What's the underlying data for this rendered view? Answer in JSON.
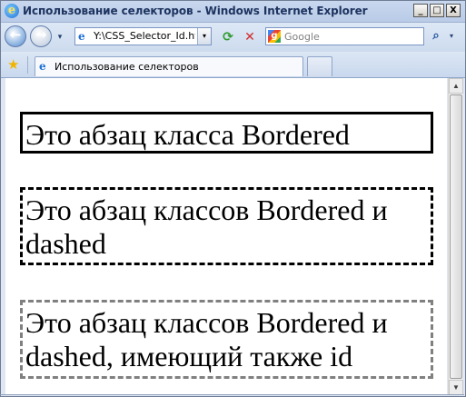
{
  "window": {
    "title": "Использование селекторов - Windows Internet Explorer",
    "app_icon_glyph": "e",
    "controls": {
      "minimize": "_",
      "maximize": "□",
      "close": "X"
    }
  },
  "navigation": {
    "back_glyph": "←",
    "forward_glyph": "→",
    "history_glyph": "▾",
    "address": "Y:\\CSS_Selector_Id.ht",
    "address_dropdown_glyph": "▾",
    "refresh_glyph": "⟳",
    "stop_glyph": "✕",
    "search_provider_icon": "g",
    "search_placeholder": "Google",
    "search_go_glyph": "⌕",
    "search_dropdown_glyph": "▾"
  },
  "tabs": {
    "favorites_glyph": "★",
    "active_tab_icon": "e",
    "active_tab_label": "Использование селекторов"
  },
  "content": {
    "paragraphs": [
      {
        "text": "Это абзац класса Bordered",
        "border_style": "solid",
        "border_color": "#000000"
      },
      {
        "text": "Это абзац классов Bordered и dashed",
        "border_style": "dashed",
        "border_color": "#000000"
      },
      {
        "text": "Это абзац классов Bordered и dashed, имеющий также id",
        "border_style": "dashed",
        "border_color": "#808080"
      }
    ]
  },
  "scrollbar": {
    "up_glyph": "▲",
    "down_glyph": "▼"
  },
  "colors": {
    "chrome": "#dfe7f3",
    "title_text": "#1e3460",
    "tab_border": "#8ea5c9"
  }
}
